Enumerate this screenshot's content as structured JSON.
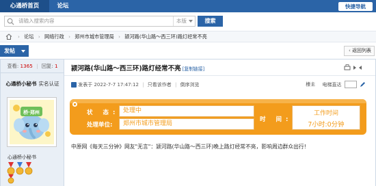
{
  "topbar": {
    "home_tab": "心通桥首页",
    "forum_tab": "论坛",
    "quick_nav": "快捷导航"
  },
  "search": {
    "placeholder": "请输入搜索内容",
    "scope": "本版",
    "button": "搜索"
  },
  "breadcrumb": [
    "论坛",
    "网络行政",
    "郑州市城市管理局",
    "颍河路(华山路～西三环)路灯经常不亮"
  ],
  "actions": {
    "post": "发帖",
    "back": "返回列表"
  },
  "sidebar": {
    "views_label": "查看:",
    "views": "1365",
    "replies_label": "回复:",
    "replies": "1",
    "username": "心通桥小秘书",
    "certified": "实名认证",
    "username_below": "心通桥小秘书",
    "avatar_text": "桥·郑州"
  },
  "post": {
    "title": "颍河路(华山路～西三环)路灯经常不亮",
    "copy_link": "[复制链接]",
    "posted_at": "发表于 2022-7-7 17:47:12",
    "author_only": "只看该作者",
    "reverse": "倒序浏览",
    "floor": "楼主",
    "reading_mode": "电梯直达",
    "status_label": "状 态:",
    "status_value": "处理中",
    "unit_label": "处理单位:",
    "unit_value": "郑州市城市管理局",
    "time_label": "时 间:",
    "time_title": "工作时间",
    "time_value": "7小时:0分钟",
    "body": "中原网《每天三分钟》网友\"无言\"：颍河路(华山路～西三环)晚上路灯经常不亮，影响周边群众出行!"
  },
  "colors": {
    "brand_blue": "#2b64a7",
    "status_orange": "#f39c1c",
    "count_red": "#cc0000"
  }
}
